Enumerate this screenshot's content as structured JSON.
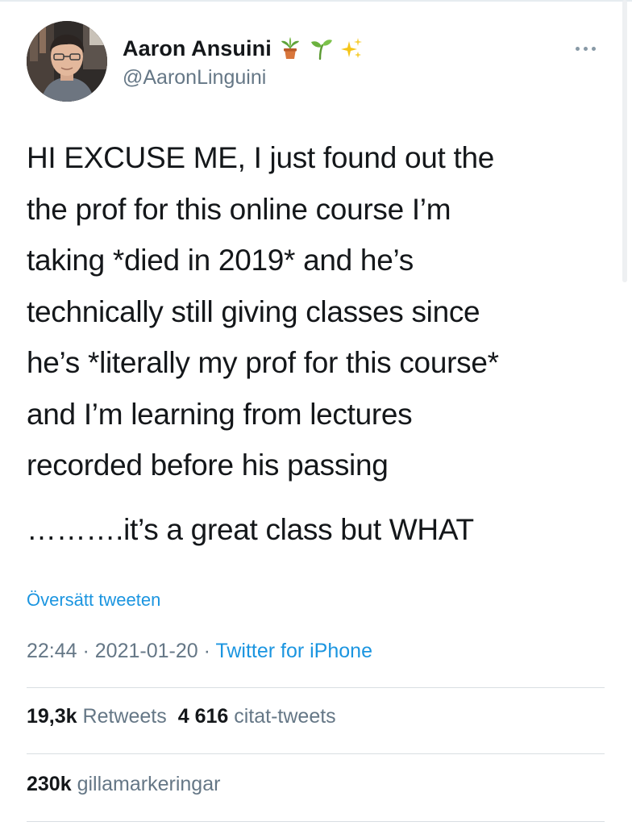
{
  "author": {
    "display_name": "Aaron Ansuini",
    "handle": "@AaronLinguini",
    "name_emojis": [
      "potted-plant-emoji",
      "seedling-emoji",
      "sparkles-emoji"
    ]
  },
  "tweet": {
    "lines": [
      "HI EXCUSE ME, I just found out the",
      "the prof for this online course I’m",
      "taking *died in 2019* and he’s",
      "technically still giving classes since",
      "he’s *literally my prof for this course*",
      "and I’m learning from lectures",
      "recorded before his passing"
    ],
    "last_line": "……….it’s a great class but WHAT"
  },
  "translate_label": "Översätt tweeten",
  "meta": {
    "time": "22:44",
    "separator": " · ",
    "date": "2021-01-20",
    "source": "Twitter for iPhone"
  },
  "stats": {
    "retweets_count": "19,3k",
    "retweets_label": "Retweets",
    "quotes_count": "4 616",
    "quotes_label": "citat-tweets",
    "likes_count": "230k",
    "likes_label": "gillamarkeringar"
  },
  "colors": {
    "text": "#14171a",
    "secondary": "#657786",
    "link": "#1b95e0",
    "divider": "#d9dee2"
  }
}
